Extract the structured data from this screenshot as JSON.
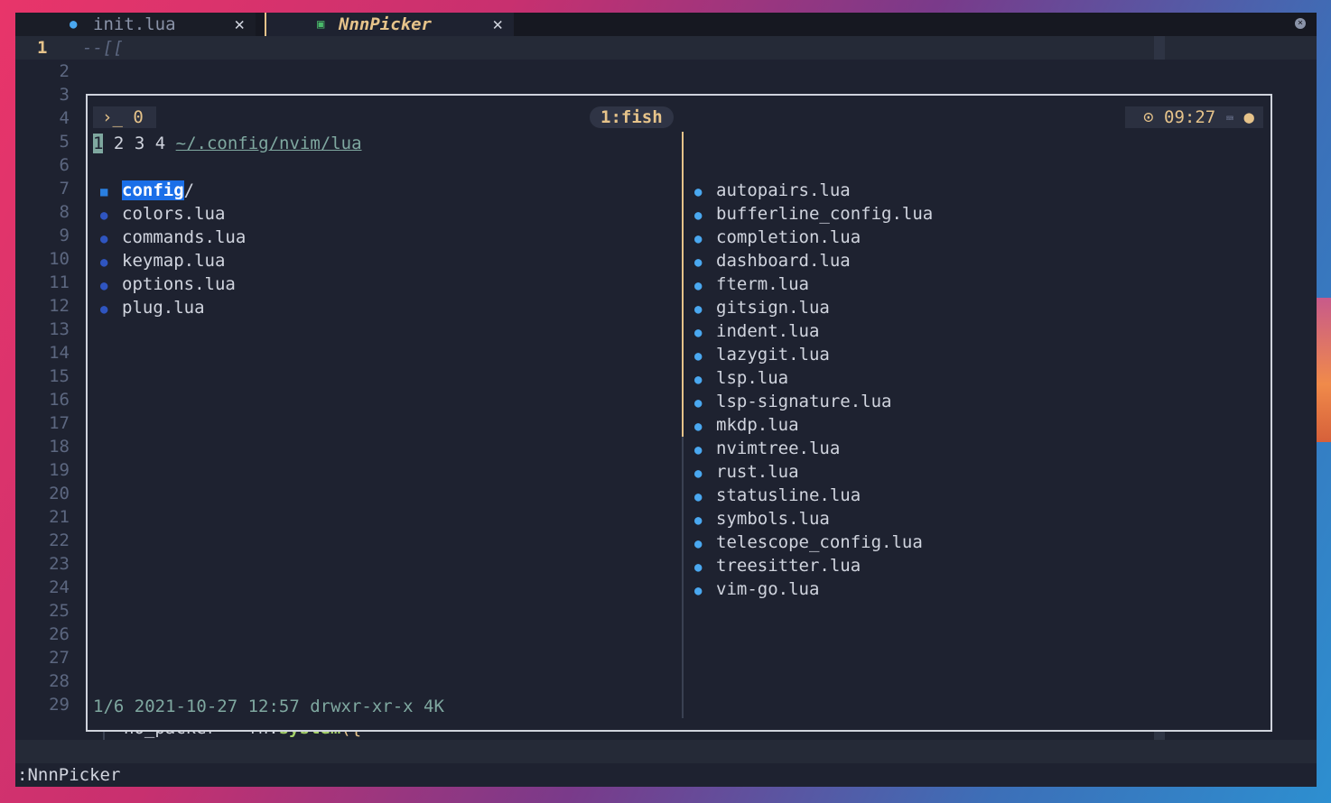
{
  "tabs": [
    {
      "icon": "lua-icon",
      "label": "init.lua",
      "close": "✕"
    },
    {
      "icon": "terminal-icon",
      "label": "NnnPicker",
      "close": "✕"
    }
  ],
  "editor": {
    "current_line_number": "1",
    "current_line_text": "--[[",
    "line_numbers": [
      "1",
      "2",
      "3",
      "4",
      "5",
      "6",
      "7",
      "8",
      "9",
      "10",
      "11",
      "12",
      "13",
      "14",
      "15",
      "16",
      "17",
      "18",
      "19",
      "20",
      "21",
      "22",
      "23",
      "24",
      "25",
      "26",
      "27",
      "28",
      "29"
    ],
    "bottom_line": {
      "var": "no_packer",
      "op": "=",
      "obj": "fn.",
      "func": "system",
      "paren": "({"
    }
  },
  "tmux": {
    "left": "0",
    "left_prompt": "›_",
    "window": "1:fish",
    "time": "09:27"
  },
  "nnn": {
    "contexts": [
      "1",
      "2",
      "3",
      "4"
    ],
    "path": "~/.config/nvim/lua",
    "left_entries": [
      {
        "name": "config",
        "suffix": "/",
        "type": "dir",
        "selected": true
      },
      {
        "name": "colors.lua",
        "type": "lua"
      },
      {
        "name": "commands.lua",
        "type": "lua"
      },
      {
        "name": "keymap.lua",
        "type": "lua"
      },
      {
        "name": "options.lua",
        "type": "lua"
      },
      {
        "name": "plug.lua",
        "type": "lua"
      }
    ],
    "status": "1/6 2021-10-27 12:57 drwxr-xr-x 4K",
    "right_entries": [
      "autopairs.lua",
      "bufferline_config.lua",
      "completion.lua",
      "dashboard.lua",
      "fterm.lua",
      "gitsign.lua",
      "indent.lua",
      "lazygit.lua",
      "lsp.lua",
      "lsp-signature.lua",
      "mkdp.lua",
      "nvimtree.lua",
      "rust.lua",
      "statusline.lua",
      "symbols.lua",
      "telescope_config.lua",
      "treesitter.lua",
      "vim-go.lua"
    ]
  },
  "cmdline": ":NnnPicker",
  "colors": {
    "accent": "#e6c38a",
    "lua_icon": "#4aa8f0",
    "selection": "#1a6fe8",
    "bg": "#1e2230"
  }
}
